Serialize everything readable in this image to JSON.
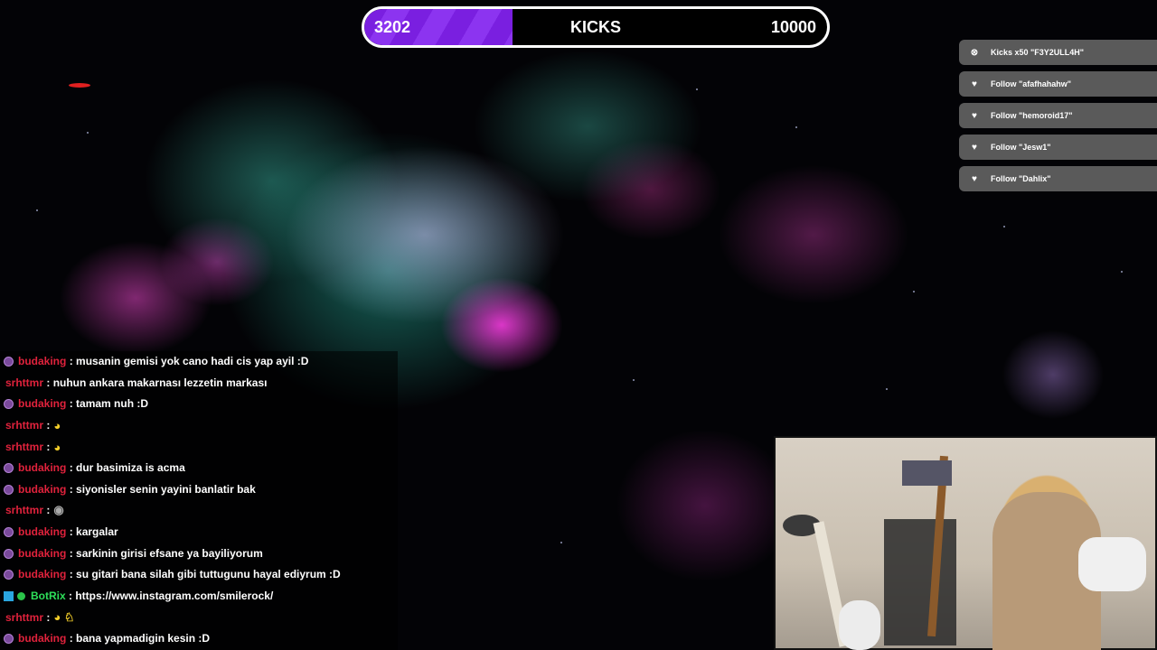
{
  "goal": {
    "current": "3202",
    "label": "KICKS",
    "target": "10000",
    "progress": 0.3202
  },
  "alerts": [
    {
      "icon": "kick-icon",
      "text": "Kicks x50 \"F3Y2ULL4H\""
    },
    {
      "icon": "heart-icon",
      "text": "Follow \"afafhahahw\""
    },
    {
      "icon": "heart-icon",
      "text": "Follow \"hemoroid17\""
    },
    {
      "icon": "heart-icon",
      "text": "Follow \"Jesw1\""
    },
    {
      "icon": "heart-icon",
      "text": "Follow \"Dahlix\""
    }
  ],
  "chat": [
    {
      "user": "budaking",
      "badge": true,
      "message": ": musanin gemisi yok cano hadi cis yap ayil :D"
    },
    {
      "user": "srhttmr",
      "badge": false,
      "message": ": nuhun ankara makarnası lezzetin markası"
    },
    {
      "user": "budaking",
      "badge": true,
      "message": ": tamam nuh :D"
    },
    {
      "user": "srhttmr",
      "badge": false,
      "message": ":",
      "emoji": "◕"
    },
    {
      "user": "srhttmr",
      "badge": false,
      "message": ":",
      "emoji": "◕"
    },
    {
      "user": "budaking",
      "badge": true,
      "message": ": dur basimiza is acma"
    },
    {
      "user": "budaking",
      "badge": true,
      "message": ": siyonisler senin yayini banlatir bak"
    },
    {
      "user": "srhttmr",
      "badge": false,
      "message": ":",
      "emoji": "◉"
    },
    {
      "user": "budaking",
      "badge": true,
      "message": ": kargalar"
    },
    {
      "user": "budaking",
      "badge": true,
      "message": ": sarkinin girisi efsane ya bayiliyorum"
    },
    {
      "user": "budaking",
      "badge": true,
      "message": ": su gitari bana silah gibi tuttugunu hayal ediyrum :D"
    },
    {
      "user": "BotRix",
      "badge": false,
      "bot": true,
      "message": ": https://www.instagram.com/smilerock/"
    },
    {
      "user": "srhttmr",
      "badge": false,
      "message": ":",
      "emoji": "◕ ♘"
    },
    {
      "user": "budaking",
      "badge": true,
      "message": ": bana yapmadigin kesin :D"
    }
  ],
  "colors": {
    "accent": "#7a1fe0",
    "chat_user": "#e0223c",
    "bot_user": "#2ee05a",
    "alert_bg": "#5a5a5a"
  }
}
